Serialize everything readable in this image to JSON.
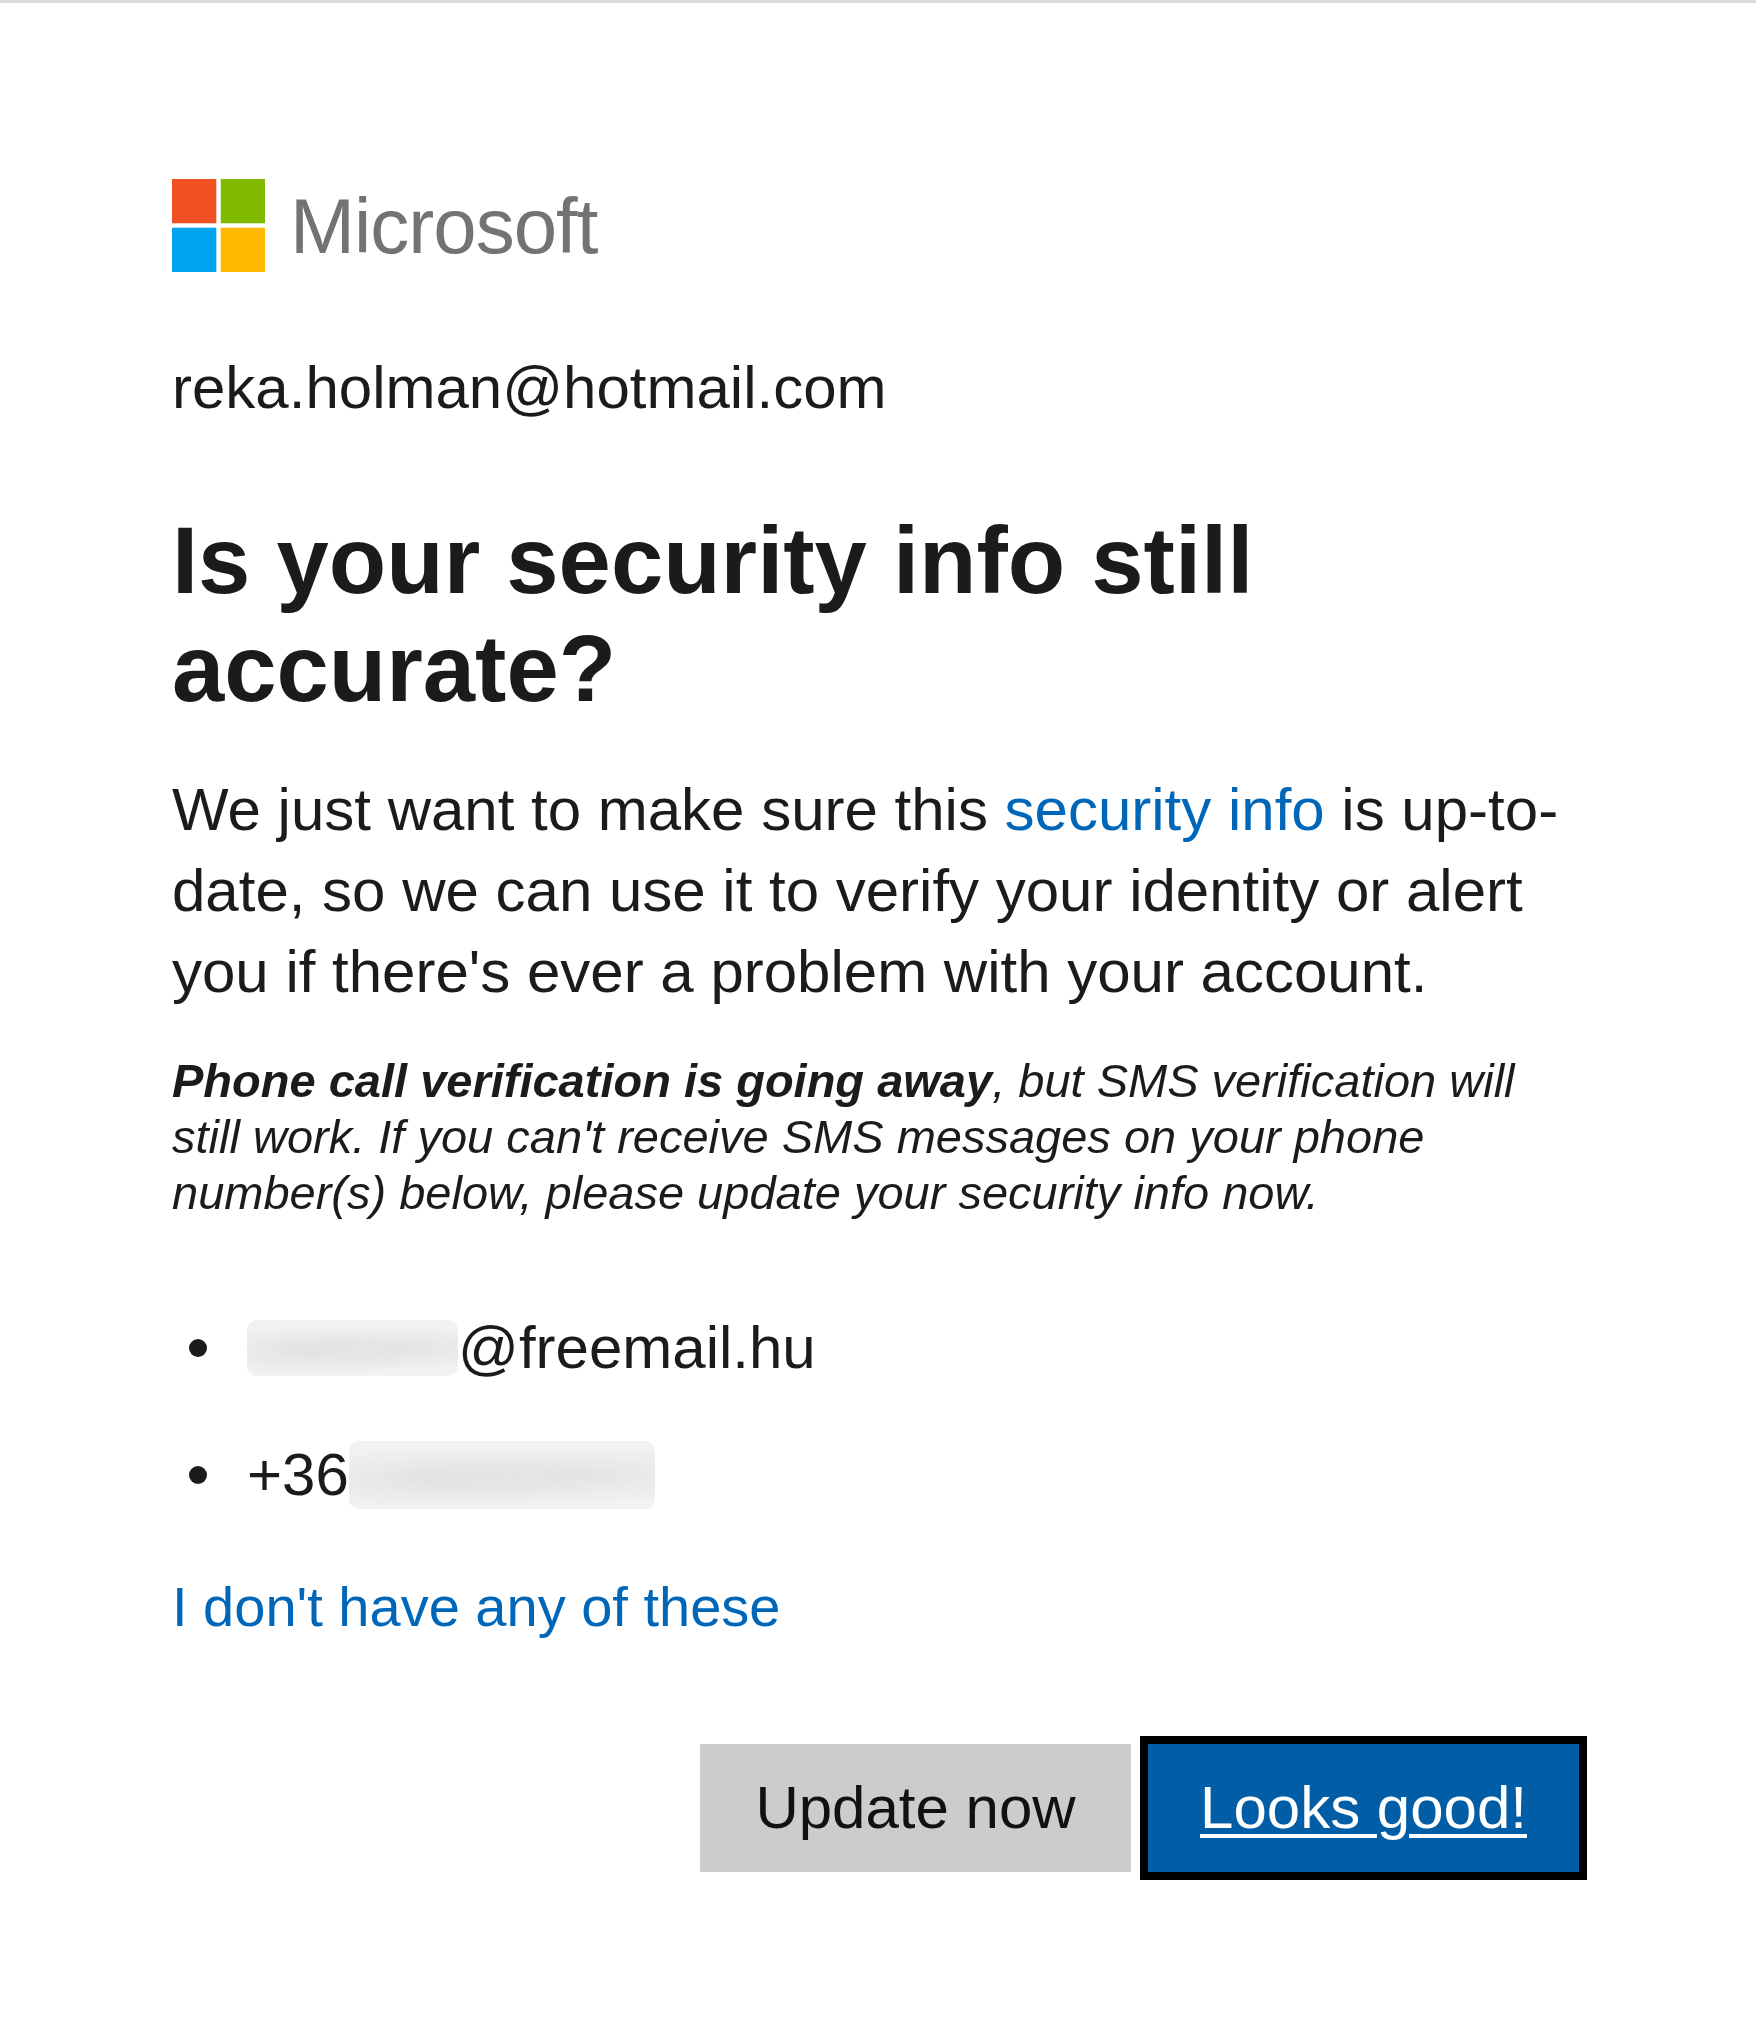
{
  "logo": {
    "brand": "Microsoft"
  },
  "account": "reka.holman@hotmail.com",
  "heading": "Is your security info still accurate?",
  "intro": {
    "before": "We just want to make sure this ",
    "link": "security info",
    "after": " is up-to-date, so we can use it to verify your identity or alert you if there's ever a problem with your account."
  },
  "notice": "**Phone call verification is going away**, but SMS verification will still work. If you can't receive SMS messages on your phone number(s) below, please update your security info now.",
  "contacts": [
    {
      "kind": "email",
      "text": "@freemail.hu"
    },
    {
      "kind": "phone",
      "text": "+36"
    }
  ],
  "alternative_link": "I don't have any of these",
  "buttons": [
    {
      "label": "Update now",
      "kind": "secondary",
      "focused": false
    },
    {
      "label": "Looks good!",
      "kind": "primary",
      "focused": true
    }
  ]
}
